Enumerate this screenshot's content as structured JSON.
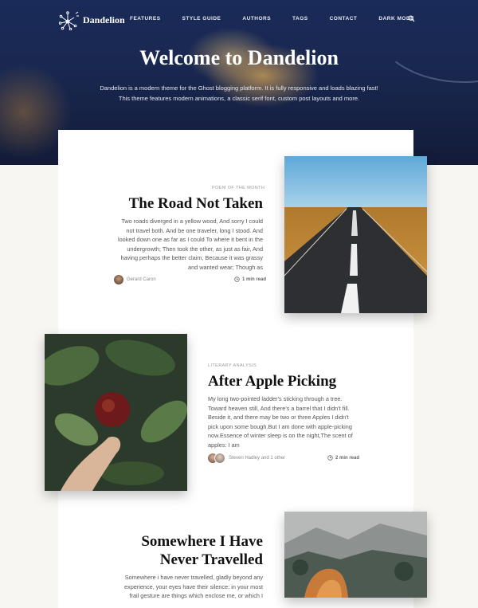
{
  "site": {
    "logo_text": "Dandelion",
    "nav": [
      "FEATURES",
      "STYLE GUIDE",
      "AUTHORS",
      "TAGS",
      "CONTACT",
      "DARK MODE"
    ],
    "search_icon": "search-icon"
  },
  "hero": {
    "title": "Welcome to Dandelion",
    "description": "Dandelion is a modern theme for the Ghost blogging platform. It is fully responsive and loads blazing fast! This theme features modern animations, a classic serif font, custom post layouts and more."
  },
  "posts": [
    {
      "tag": "POEM OF THE MONTH",
      "title": "The Road Not Taken",
      "excerpt": "Two roads diverged in a yellow wood, And sorry I could not travel both. And be one traveler, long I stood. And looked down one as far as I could To where it bent in the undergrowth; Then took the other, as just as fair, And having perhaps the better claim, Because it was grassy and wanted wear; Though as",
      "author": "Gerard Caron",
      "read_time": "1 min read"
    },
    {
      "tag": "LITERARY ANALYSIS",
      "title": "After Apple Picking",
      "excerpt": "My long two-pointed ladder's sticking through a tree. Toward heaven still, And there's a barrel that I didn't fill. Beside it, and there may be two or three Apples I didn't pick upon some bough.But I am done with apple-picking now.Essence of winter sleep is on the night,The scent of apples: I am",
      "author": "Steven Hadley and 1 other",
      "read_time": "2 min read"
    },
    {
      "title": "Somewhere I Have Never Travelled",
      "excerpt": "Somewhere i have never travelled, gladly beyond any experience, your eyes have their silence: in your most frail gesture are things which enclose me, or which I"
    }
  ]
}
